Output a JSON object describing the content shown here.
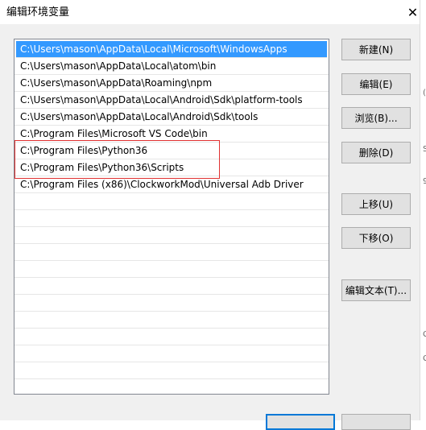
{
  "window": {
    "title": "编辑环境变量",
    "close_glyph": "✕"
  },
  "path_list": {
    "selected_index": 0,
    "items": [
      "C:\\Users\\mason\\AppData\\Local\\Microsoft\\WindowsApps",
      "C:\\Users\\mason\\AppData\\Local\\atom\\bin",
      "C:\\Users\\mason\\AppData\\Roaming\\npm",
      "C:\\Users\\mason\\AppData\\Local\\Android\\Sdk\\platform-tools",
      "C:\\Users\\mason\\AppData\\Local\\Android\\Sdk\\tools",
      "C:\\Program Files\\Microsoft VS Code\\bin",
      "C:\\Program Files\\Python36",
      "C:\\Program Files\\Python36\\Scripts",
      "C:\\Program Files (x86)\\ClockworkMod\\Universal Adb Driver",
      "",
      "",
      "",
      "",
      "",
      "",
      "",
      "",
      "",
      "",
      "",
      ""
    ]
  },
  "buttons": {
    "new": "新建(N)",
    "edit": "编辑(E)",
    "browse": "浏览(B)...",
    "delete": "删除(D)",
    "move_up": "上移(U)",
    "move_down": "下移(O)",
    "edit_text": "编辑文本(T)..."
  },
  "colors": {
    "selection": "#3399ff",
    "highlight_box": "#e03131",
    "primary_button_border": "#0078d7"
  }
}
